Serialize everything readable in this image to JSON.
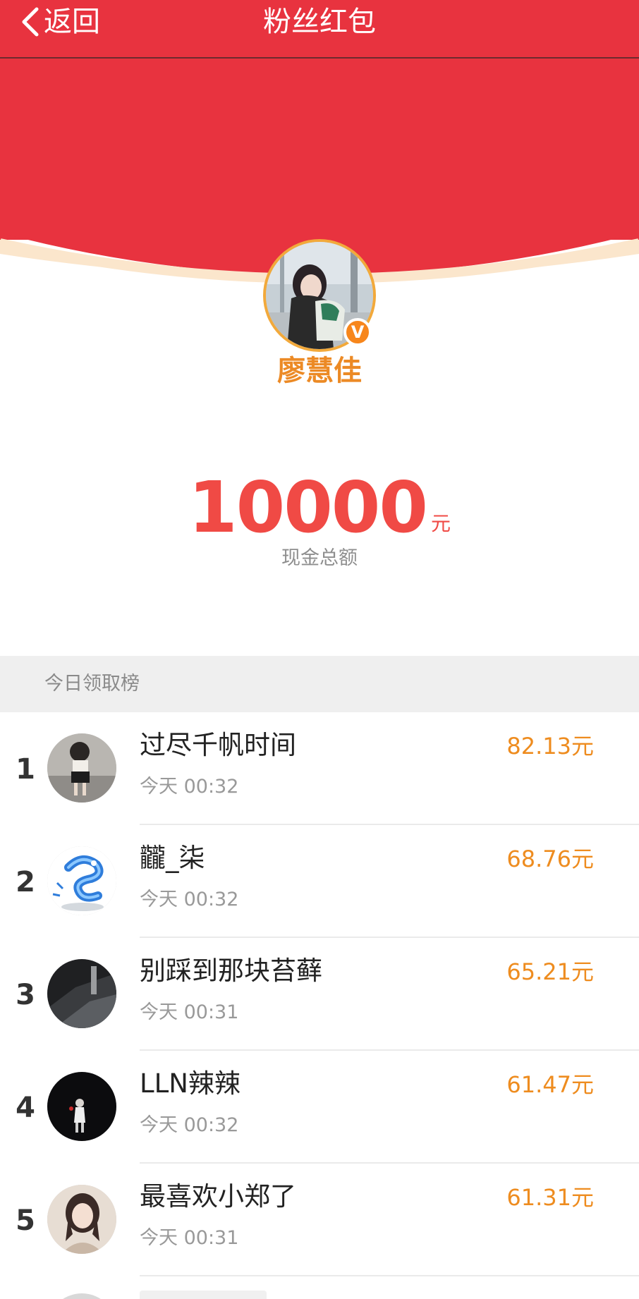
{
  "header": {
    "back_label": "返回",
    "title": "粉丝红包",
    "bg_color": "#e8333f"
  },
  "host": {
    "name": "廖慧佳",
    "verified_badge": "V",
    "avatar_icon": "user-photo"
  },
  "total": {
    "amount": "10000",
    "unit": "元",
    "caption": "现金总额"
  },
  "ranking": {
    "title": "今日领取榜",
    "rows": [
      {
        "rank": "1",
        "name": "过尽千帆时间",
        "time": "今天 00:32",
        "money": "82.13元"
      },
      {
        "rank": "2",
        "name": "龖_柒",
        "time": "今天 00:32",
        "money": "68.76元"
      },
      {
        "rank": "3",
        "name": "别踩到那块苔藓",
        "time": "今天 00:31",
        "money": "65.21元"
      },
      {
        "rank": "4",
        "name": "LLN辣辣",
        "time": "今天 00:32",
        "money": "61.47元"
      },
      {
        "rank": "5",
        "name": "最喜欢小郑了",
        "time": "今天 00:31",
        "money": "61.31元"
      }
    ]
  },
  "colors": {
    "accent_red": "#e8333f",
    "amount_red": "#f04a45",
    "money_orange": "#ee8c1f",
    "name_orange": "#ec8a25"
  }
}
